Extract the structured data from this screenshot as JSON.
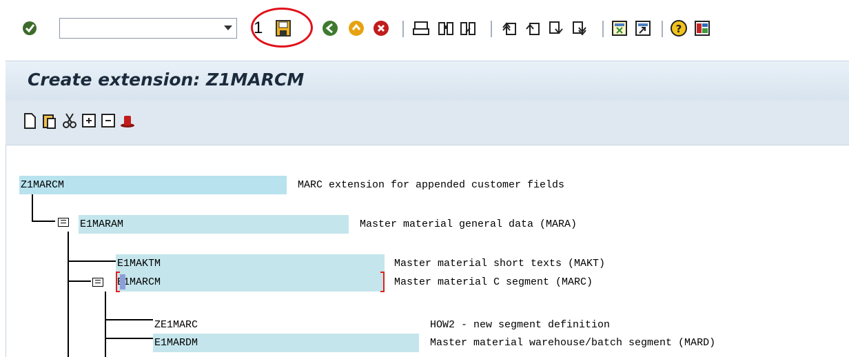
{
  "toolbar": {
    "command_field_value": "",
    "count_label": "1",
    "icons": [
      "enter-check-icon",
      "save-icon",
      "back-icon",
      "exit-icon",
      "cancel-icon",
      "print-icon",
      "find-icon",
      "find-next-icon",
      "first-page-icon",
      "previous-page-icon",
      "next-page-icon",
      "last-page-icon",
      "create-session-icon",
      "shortcut-icon",
      "help-icon",
      "layout-menu-icon"
    ]
  },
  "title": "Create extension: Z1MARCM",
  "app_toolbar": {
    "icons": [
      "create-icon",
      "paste-icon",
      "cut-icon",
      "expand-icon",
      "collapse-icon",
      "hat-icon"
    ]
  },
  "tree": {
    "root": {
      "name": "Z1MARCM",
      "desc": "MARC extension for appended customer fields"
    },
    "nodes": [
      {
        "name": "E1MARAM",
        "desc": "Master material general data (MARA)"
      },
      {
        "name": "E1MAKTM",
        "desc": "Master material short texts (MAKT)"
      },
      {
        "name": "E1MARCM",
        "desc": "Master material C segment (MARC)"
      },
      {
        "name": "ZE1MARC",
        "desc": "HOW2 - new segment definition"
      },
      {
        "name": "E1MARDM",
        "desc": "Master material warehouse/batch segment (MARD)"
      }
    ]
  },
  "colors": {
    "node_highlight": "#b8e2ee",
    "annotation": "#e0101a",
    "title_bg": "#dfe8f1"
  }
}
